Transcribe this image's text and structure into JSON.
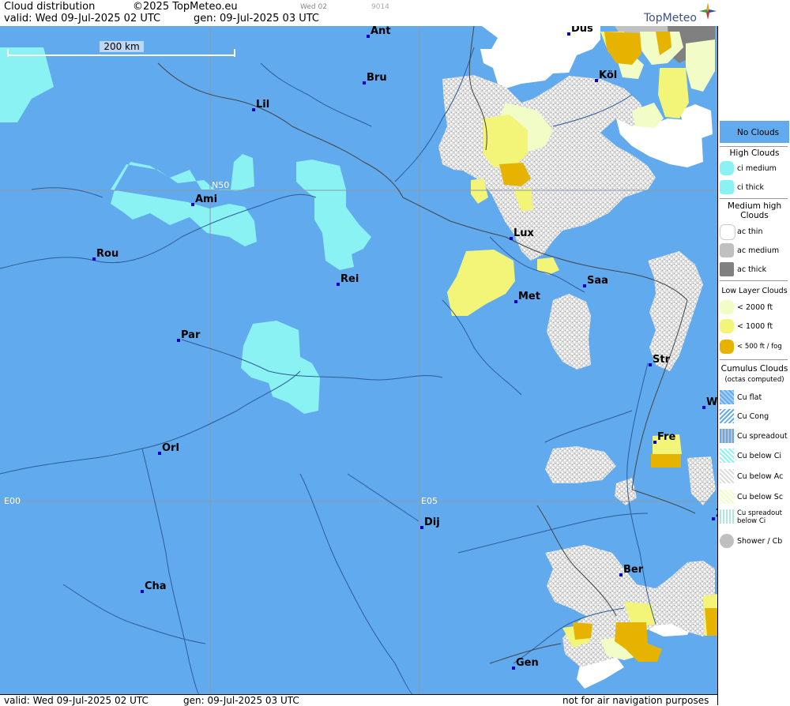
{
  "header": {
    "title": "Cloud distribution",
    "copyright": "©2025 TopMeteo.eu",
    "small_day": "Wed 02",
    "small_code": "9014",
    "valid": "valid:  Wed  09-Jul-2025  02 UTC",
    "gen": "gen: 09-Jul-2025 03 UTC",
    "brand": "TopMeteo"
  },
  "footer": {
    "valid": "valid:  Wed  09-Jul-2025  02 UTC",
    "gen": "gen: 09-Jul-2025 03 UTC",
    "disclaimer": "not for air navigation purposes"
  },
  "scale_bar": {
    "label": "200 km"
  },
  "grid_labels": {
    "lat": "N50",
    "lon0": "E00",
    "lon5": "E05"
  },
  "cities": [
    {
      "name": "Ant"
    },
    {
      "name": "Düs"
    },
    {
      "name": "Köl"
    },
    {
      "name": "Bru"
    },
    {
      "name": "Lil"
    },
    {
      "name": "Ami"
    },
    {
      "name": "Rou"
    },
    {
      "name": "Rei"
    },
    {
      "name": "Lux"
    },
    {
      "name": "Saa"
    },
    {
      "name": "Met"
    },
    {
      "name": "Par"
    },
    {
      "name": "Str"
    },
    {
      "name": "W"
    },
    {
      "name": "Fre"
    },
    {
      "name": "Orl"
    },
    {
      "name": "Dij"
    },
    {
      "name": "Ber"
    },
    {
      "name": "Cha"
    },
    {
      "name": "Gen"
    },
    {
      "name": "Z"
    }
  ],
  "legend": {
    "no_clouds": "No Clouds",
    "high_title": "High Clouds",
    "ci_medium": "ci medium",
    "ci_thick": "ci thick",
    "medium_title": "Medium high Clouds",
    "ac_thin": "ac thin",
    "ac_medium": "ac medium",
    "ac_thick": "ac thick",
    "low_title": "Low Layer Clouds",
    "low_2000": "< 2000 ft",
    "low_1000": "< 1000 ft",
    "low_500": "< 500 ft / fog",
    "cu_title": "Cumulus Clouds",
    "cu_sub": "(octas computed)",
    "cu_flat": "Cu flat",
    "cu_cong": "Cu Cong",
    "cu_spread": "Cu spreadout",
    "cu_below_ci": "Cu below Ci",
    "cu_below_ac": "Cu below Ac",
    "cu_below_sc": "Cu below Sc",
    "cu_spread_below_ci": "Cu spreadout below Ci",
    "shower": "Shower / Cb"
  },
  "colors": {
    "no_clouds": "#62aaee",
    "ci": "#8af2f2",
    "ac_thin": "#ffffff",
    "ac_medium": "#c0c0c0",
    "ac_thick": "#808080",
    "low_2000": "#f2fcc6",
    "low_1000": "#f2f578",
    "low_500": "#e6b400"
  }
}
